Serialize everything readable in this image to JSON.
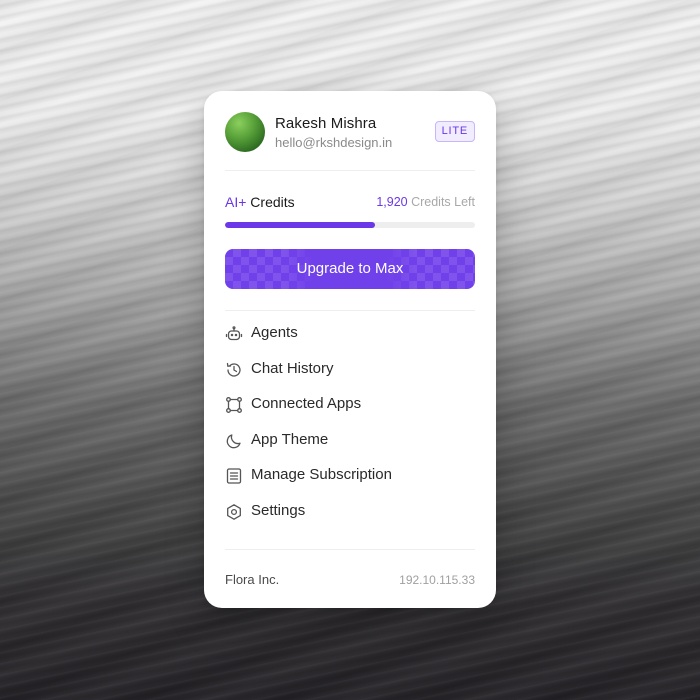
{
  "profile": {
    "name": "Rakesh Mishra",
    "email": "hello@rkshdesign.in",
    "plan": "LITE"
  },
  "credits": {
    "prefix": "AI+",
    "label": "Credits",
    "count": "1,920",
    "suffix": "Credits Left",
    "progress_fraction": 0.6
  },
  "upgrade": {
    "label": "Upgrade to Max"
  },
  "menu": {
    "items": [
      {
        "label": "Agents",
        "icon": "robot-icon"
      },
      {
        "label": "Chat History",
        "icon": "history-icon"
      },
      {
        "label": "Connected Apps",
        "icon": "nodes-icon"
      },
      {
        "label": "App Theme",
        "icon": "moon-icon"
      },
      {
        "label": "Manage Subscription",
        "icon": "document-icon"
      },
      {
        "label": "Settings",
        "icon": "hexagon-gear-icon"
      }
    ]
  },
  "footer": {
    "org": "Flora Inc.",
    "ip": "192.10.115.33"
  },
  "colors": {
    "accent": "#6b37e8",
    "upgrade": "#7040ea"
  }
}
